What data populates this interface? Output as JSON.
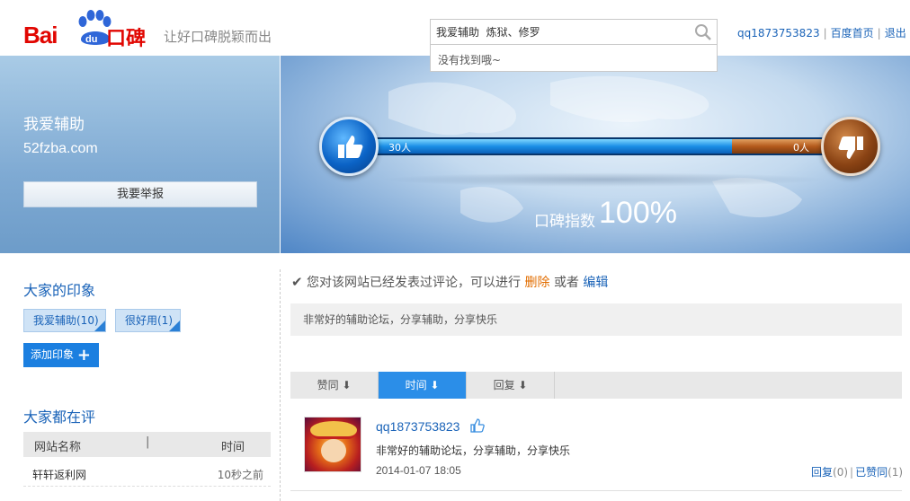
{
  "header": {
    "logo_bai": "Bai",
    "logo_du": "du",
    "logo_koubei": "口碑",
    "slogan": "让好口碑脱颖而出",
    "search_value": "我爱辅助  炼狱、修罗",
    "search_dropdown": "没有找到哦~",
    "user": "qq1873753823",
    "home_link": "百度首页",
    "logout_link": "退出"
  },
  "site": {
    "name": "我爱辅助",
    "domain": "52fzba.com",
    "report_button": "我要举报"
  },
  "rating": {
    "good_count": "30人",
    "bad_count": "0人",
    "good_fraction": 1.0,
    "score_label": "口碑指数",
    "score_value": "100%"
  },
  "impressions": {
    "title": "大家的印象",
    "tags": [
      {
        "label": "我爱辅助(10)"
      },
      {
        "label": "很好用(1)"
      }
    ],
    "add_button": "添加印象"
  },
  "reviews_list": {
    "title": "大家都在评",
    "col_name": "网站名称",
    "col_divider": "|",
    "col_time": "时间",
    "rows": [
      {
        "name": "轩轩返利网",
        "time": "10秒之前"
      }
    ]
  },
  "my_review": {
    "notice_prefix": "您对该网站已经发表过评论，可以进行",
    "delete_link": "删除",
    "notice_or": "或者",
    "edit_link": "编辑",
    "preview": "非常好的辅助论坛，分享辅助，分享快乐"
  },
  "sort_tabs": [
    {
      "label": "赞同 ⬇"
    },
    {
      "label": "时间 ⬇"
    },
    {
      "label": "回复 ⬇"
    }
  ],
  "comments": [
    {
      "user": "qq1873753823",
      "text": "非常好的辅助论坛，分享辅助，分享快乐",
      "time": "2014-01-07 18:05",
      "reply_label": "回复",
      "reply_count": "(0)",
      "sep": "|",
      "liked_label": "已赞同",
      "liked_count": "(1)"
    }
  ],
  "colors": {
    "brand_red": "#e10601",
    "link_blue": "#1a63b8",
    "accent_blue": "#2b8ee8",
    "delete_orange": "#e26d00"
  }
}
